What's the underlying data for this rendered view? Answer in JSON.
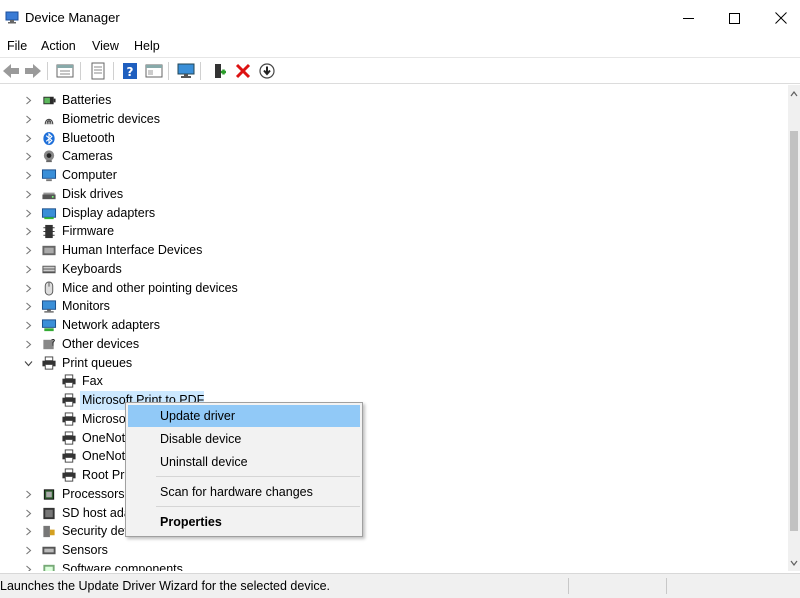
{
  "window": {
    "title": "Device Manager"
  },
  "menu": [
    "File",
    "Action",
    "View",
    "Help"
  ],
  "toolbar": {
    "icons": [
      "back-arrow-icon",
      "forward-arrow-icon",
      "device-tree-icon",
      "properties-icon",
      "help-icon",
      "view-icon",
      "monitor-scan-icon",
      "add-driver-icon",
      "uninstall-x-icon",
      "download-icon"
    ]
  },
  "tree": [
    {
      "label": "Batteries",
      "icon": "battery-icon"
    },
    {
      "label": "Biometric devices",
      "icon": "fingerprint-icon"
    },
    {
      "label": "Bluetooth",
      "icon": "bluetooth-icon"
    },
    {
      "label": "Cameras",
      "icon": "camera-icon"
    },
    {
      "label": "Computer",
      "icon": "computer-icon"
    },
    {
      "label": "Disk drives",
      "icon": "disk-drive-icon"
    },
    {
      "label": "Display adapters",
      "icon": "display-adapter-icon"
    },
    {
      "label": "Firmware",
      "icon": "firmware-icon"
    },
    {
      "label": "Human Interface Devices",
      "icon": "hid-icon"
    },
    {
      "label": "Keyboards",
      "icon": "keyboard-icon"
    },
    {
      "label": "Mice and other pointing devices",
      "icon": "mouse-icon"
    },
    {
      "label": "Monitors",
      "icon": "monitor-icon"
    },
    {
      "label": "Network adapters",
      "icon": "network-adapter-icon"
    },
    {
      "label": "Other devices",
      "icon": "other-devices-icon"
    },
    {
      "label": "Print queues",
      "icon": "printer-icon",
      "expanded": true
    },
    {
      "label": "Fax",
      "icon": "printer-icon",
      "child": true
    },
    {
      "label": "Microsoft Print to PDF",
      "icon": "printer-icon",
      "child": true,
      "selected": true
    },
    {
      "label": "Microsoft XPS Document Writer",
      "icon": "printer-icon",
      "child": true
    },
    {
      "label": "OneNote (Desktop)",
      "icon": "printer-icon",
      "child": true
    },
    {
      "label": "OneNote for Windows 10",
      "icon": "printer-icon",
      "child": true
    },
    {
      "label": "Root Print Queue",
      "icon": "printer-icon",
      "child": true
    },
    {
      "label": "Processors",
      "icon": "processor-icon"
    },
    {
      "label": "SD host adapters",
      "icon": "sd-host-icon"
    },
    {
      "label": "Security devices",
      "icon": "security-device-icon"
    },
    {
      "label": "Sensors",
      "icon": "sensor-icon"
    },
    {
      "label": "Software components",
      "icon": "software-component-icon"
    }
  ],
  "context_menu": {
    "update_driver": "Update driver",
    "disable_device": "Disable device",
    "uninstall_device": "Uninstall device",
    "scan_hardware": "Scan for hardware changes",
    "properties": "Properties"
  },
  "status": {
    "text": "Launches the Update Driver Wizard for the selected device."
  }
}
